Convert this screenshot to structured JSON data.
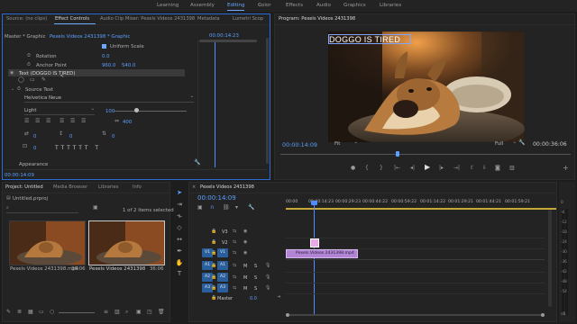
{
  "workspaces": {
    "learning": "Learning",
    "assembly": "Assembly",
    "editing": "Editing",
    "color": "Color",
    "effects": "Effects",
    "audio": "Audio",
    "graphics": "Graphics",
    "libraries": "Libraries"
  },
  "effect_panel": {
    "tab_source": "Source: (no clips)",
    "tab_effect": "Effect Controls",
    "tab_audio": "Audio Clip Mixer: Pexels Videos 2431398",
    "tab_meta": "Metadata",
    "tab_lumetri": "Lumetri Scop",
    "crumb_master": "Master * Graphic",
    "crumb_clip": "Pexels Videos 2431398 * Graphic",
    "ruler_time": "00:00:14:23",
    "uniform_scale": "Uniform Scale",
    "rotation_label": "Rotation",
    "rotation_value": "0.0",
    "anchor_label": "Anchor Point",
    "anchor_x": "960.0",
    "anchor_y": "540.0",
    "text_layer": "Text (DOGGO IS TIRED)",
    "source_text": "Source Text",
    "font": "Helvetica Neue",
    "style": "Light",
    "size_value": "100",
    "tracking_value": "400",
    "v0a": "0",
    "v0b": "0",
    "v0c": "0",
    "v0d": "0",
    "appearance": "Appearance",
    "timecode": "00:00:14:09"
  },
  "program": {
    "title": "Program: Pexels Videos 2431398",
    "overlay_text": "DOGGO IS TIRED",
    "timecode": "00:00:14:09",
    "fit": "Fit",
    "full": "Full",
    "duration": "00:00:36:06"
  },
  "project": {
    "tab_project": "Project: Untitled",
    "tab_media": "Media Browser",
    "tab_libraries": "Libraries",
    "tab_info": "Info",
    "file": "Untitled.prproj",
    "selected": "1 of 2 items selected",
    "items": [
      {
        "name": "Pexels Videos 2431398.mp4",
        "dur": "36:06"
      },
      {
        "name": "Pexels Videos 2431398",
        "dur": "36:06"
      }
    ]
  },
  "timeline": {
    "title": "Pexels Videos 2431398",
    "timecode": "00:00:14:09",
    "ruler": [
      "00:00",
      "00:00:14:23",
      "00:00:29:23",
      "00:00:44:22",
      "00:00:59:22",
      "00:01:14:22",
      "00:01:29:21",
      "00:01:44:21",
      "00:01:59:21"
    ],
    "tracks": {
      "v3": "V3",
      "v2": "V2",
      "v1": "V1",
      "a1": "A1",
      "a2": "A2",
      "a3": "A3",
      "master": "Master",
      "master_val": "0.0"
    },
    "clip_label": "Pexels Videos 2431398.mp4",
    "meter_marks": [
      "0",
      "-6",
      "-12",
      "-18",
      "-24",
      "-30",
      "-36",
      "-42",
      "-48",
      "-54",
      "dB"
    ]
  },
  "colors": {
    "accent": "#2d6bd4",
    "timecode": "#5ba0ff",
    "clip_pink": "#e8a7e6",
    "clip_violet": "#b184d4",
    "playhead": "#4f8cff"
  }
}
